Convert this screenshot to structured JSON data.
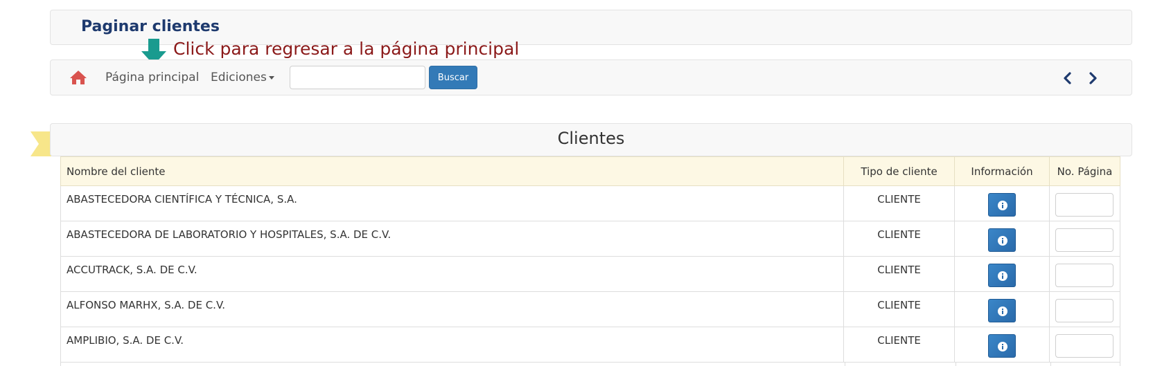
{
  "page_title": "Paginar clientes",
  "hint_text": "Click para regresar a la página principal",
  "nav": {
    "home_icon": "home-icon",
    "home_link": "Página principal",
    "ediciones": "Ediciones",
    "search_value": "",
    "search_button": "Buscar",
    "prev_icon": "chevron-left-icon",
    "next_icon": "chevron-right-icon"
  },
  "colors": {
    "accent": "#337ab7",
    "title": "#1e3a6e",
    "hint": "#8b1a1a",
    "home_icon": "#d9534f",
    "arrow": "#1a9b8f",
    "table_header_bg": "#fdf8e4",
    "ribbon": "#f7e68a"
  },
  "list": {
    "title": "Clientes",
    "headers": {
      "name": "Nombre del cliente",
      "tipo": "Tipo de cliente",
      "info": "Información",
      "page": "No. Página"
    },
    "rows": [
      {
        "name": "ABASTECEDORA CIENTÍFICA Y TÉCNICA, S.A.",
        "tipo": "CLIENTE",
        "page": ""
      },
      {
        "name": "ABASTECEDORA DE LABORATORIO Y HOSPITALES, S.A. DE C.V.",
        "tipo": "CLIENTE",
        "page": ""
      },
      {
        "name": "ACCUTRACK, S.A. DE C.V.",
        "tipo": "CLIENTE",
        "page": ""
      },
      {
        "name": "ALFONSO MARHX, S.A. DE C.V.",
        "tipo": "CLIENTE",
        "page": ""
      },
      {
        "name": "AMPLIBIO, S.A. DE C.V.",
        "tipo": "CLIENTE",
        "page": ""
      }
    ]
  }
}
